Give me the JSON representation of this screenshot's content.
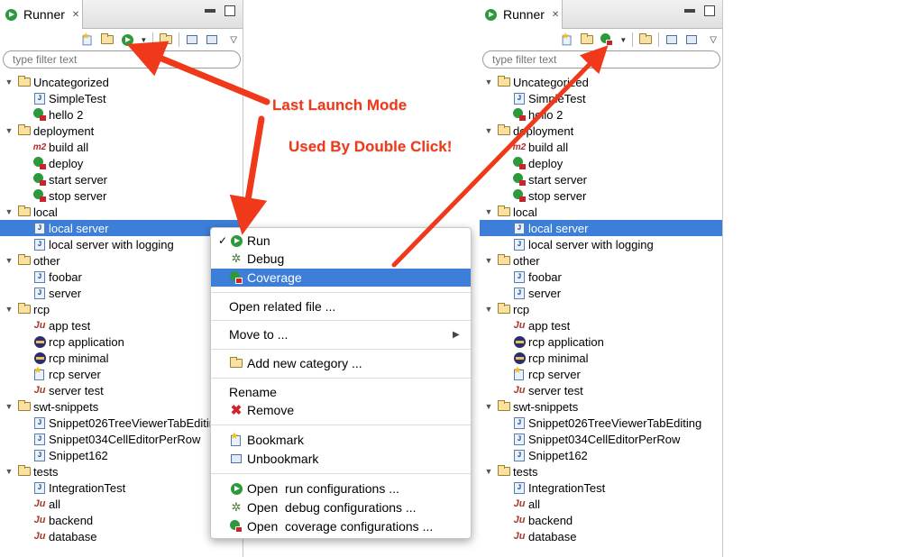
{
  "panels": [
    {
      "tab_label": "Runner",
      "toolbar_mode": "run",
      "filter_placeholder": "type filter text",
      "selected_index": 9,
      "tree": [
        {
          "label": "Uncategorized",
          "type": "folder",
          "level": 0
        },
        {
          "label": "SimpleTest",
          "type": "java",
          "level": 1
        },
        {
          "label": "hello 2",
          "type": "runred",
          "level": 1
        },
        {
          "label": "deployment",
          "type": "folder",
          "level": 0
        },
        {
          "label": "build all",
          "type": "m2",
          "level": 1
        },
        {
          "label": "deploy",
          "type": "runred",
          "level": 1
        },
        {
          "label": "start server",
          "type": "runred",
          "level": 1
        },
        {
          "label": "stop server",
          "type": "runred",
          "level": 1
        },
        {
          "label": "local",
          "type": "folder",
          "level": 0
        },
        {
          "label": "local server",
          "type": "java",
          "level": 1
        },
        {
          "label": "local server with logging",
          "type": "java",
          "level": 1
        },
        {
          "label": "other",
          "type": "folder",
          "level": 0
        },
        {
          "label": "foobar",
          "type": "java",
          "level": 1
        },
        {
          "label": "server",
          "type": "java",
          "level": 1
        },
        {
          "label": "rcp",
          "type": "folder",
          "level": 0
        },
        {
          "label": "app test",
          "type": "junit",
          "level": 1
        },
        {
          "label": "rcp application",
          "type": "eclipse",
          "level": 1
        },
        {
          "label": "rcp minimal",
          "type": "eclipse",
          "level": 1
        },
        {
          "label": "rcp server",
          "type": "star",
          "level": 1
        },
        {
          "label": "server test",
          "type": "junit",
          "level": 1
        },
        {
          "label": "swt-snippets",
          "type": "folder",
          "level": 0
        },
        {
          "label": "Snippet026TreeViewerTabEditing",
          "type": "java",
          "level": 1
        },
        {
          "label": "Snippet034CellEditorPerRow",
          "type": "java",
          "level": 1
        },
        {
          "label": "Snippet162",
          "type": "java",
          "level": 1
        },
        {
          "label": "tests",
          "type": "folder",
          "level": 0
        },
        {
          "label": "IntegrationTest",
          "type": "java",
          "level": 1
        },
        {
          "label": "all",
          "type": "junit",
          "level": 1
        },
        {
          "label": "backend",
          "type": "junit",
          "level": 1
        },
        {
          "label": "database",
          "type": "junit",
          "level": 1
        }
      ]
    },
    {
      "tab_label": "Runner",
      "toolbar_mode": "coverage",
      "filter_placeholder": "type filter text",
      "selected_index": 9,
      "tree": [
        {
          "label": "Uncategorized",
          "type": "folder",
          "level": 0
        },
        {
          "label": "SimpleTest",
          "type": "java",
          "level": 1
        },
        {
          "label": "hello 2",
          "type": "runred",
          "level": 1
        },
        {
          "label": "deployment",
          "type": "folder",
          "level": 0
        },
        {
          "label": "build all",
          "type": "m2",
          "level": 1
        },
        {
          "label": "deploy",
          "type": "runred",
          "level": 1
        },
        {
          "label": "start server",
          "type": "runred",
          "level": 1
        },
        {
          "label": "stop server",
          "type": "runred",
          "level": 1
        },
        {
          "label": "local",
          "type": "folder",
          "level": 0
        },
        {
          "label": "local server",
          "type": "java",
          "level": 1
        },
        {
          "label": "local server with logging",
          "type": "java",
          "level": 1
        },
        {
          "label": "other",
          "type": "folder",
          "level": 0
        },
        {
          "label": "foobar",
          "type": "java",
          "level": 1
        },
        {
          "label": "server",
          "type": "java",
          "level": 1
        },
        {
          "label": "rcp",
          "type": "folder",
          "level": 0
        },
        {
          "label": "app test",
          "type": "junit",
          "level": 1
        },
        {
          "label": "rcp application",
          "type": "eclipse",
          "level": 1
        },
        {
          "label": "rcp minimal",
          "type": "eclipse",
          "level": 1
        },
        {
          "label": "rcp server",
          "type": "star",
          "level": 1
        },
        {
          "label": "server test",
          "type": "junit",
          "level": 1
        },
        {
          "label": "swt-snippets",
          "type": "folder",
          "level": 0
        },
        {
          "label": "Snippet026TreeViewerTabEditing",
          "type": "java",
          "level": 1
        },
        {
          "label": "Snippet034CellEditorPerRow",
          "type": "java",
          "level": 1
        },
        {
          "label": "Snippet162",
          "type": "java",
          "level": 1
        },
        {
          "label": "tests",
          "type": "folder",
          "level": 0
        },
        {
          "label": "IntegrationTest",
          "type": "java",
          "level": 1
        },
        {
          "label": "all",
          "type": "junit",
          "level": 1
        },
        {
          "label": "backend",
          "type": "junit",
          "level": 1
        },
        {
          "label": "database",
          "type": "junit",
          "level": 1
        }
      ]
    }
  ],
  "context_menu": {
    "run": "Run",
    "debug": "Debug",
    "coverage": "Coverage",
    "open_related": "Open related file ...",
    "move_to": "Move to ...",
    "add_category": "Add new category ...",
    "rename": "Rename",
    "remove": "Remove",
    "bookmark": "Bookmark",
    "unbookmark": "Unbookmark",
    "open_run": "Open  run configurations ...",
    "open_debug": "Open  debug configurations ...",
    "open_coverage": "Open  coverage configurations ..."
  },
  "annotations": {
    "last_launch_mode": "Last Launch Mode",
    "used_by_double_click": "Used By Double Click!"
  },
  "colors": {
    "selection": "#3d7ed8",
    "annotation": "#f0391a"
  }
}
